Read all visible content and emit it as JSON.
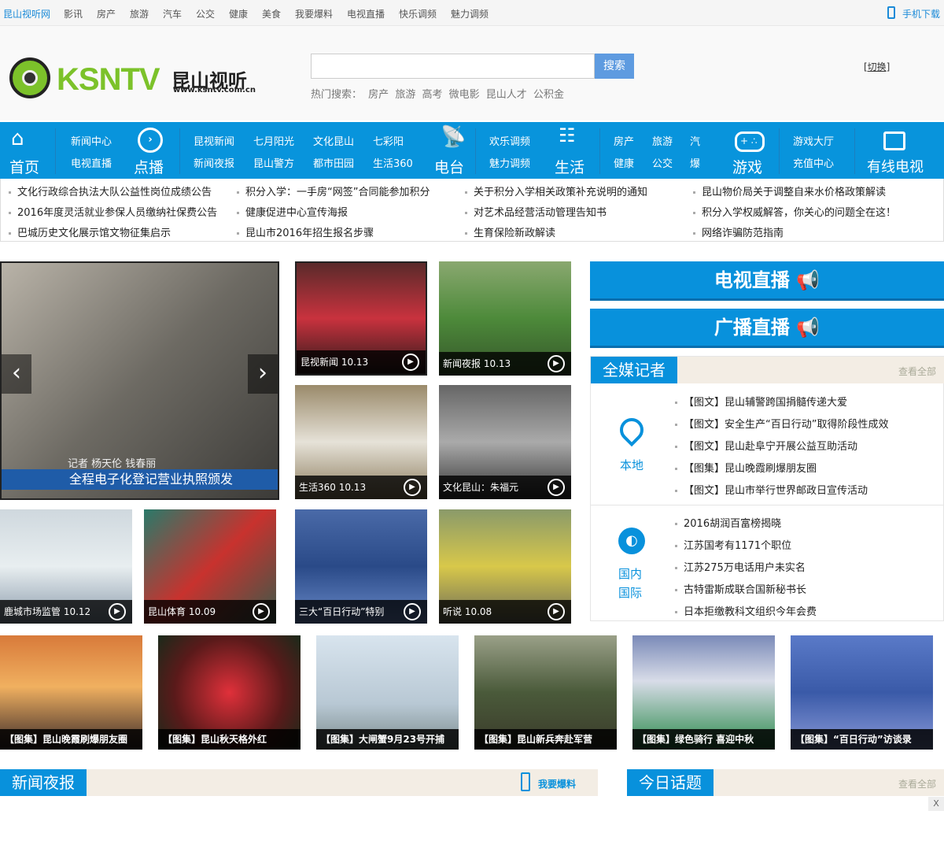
{
  "topbar": {
    "brand": "昆山视听网",
    "links": [
      "影讯",
      "房产",
      "旅游",
      "汽车",
      "公交",
      "健康",
      "美食",
      "我要爆料",
      "电视直播",
      "快乐调频",
      "魅力调频"
    ],
    "mobile": "手机下载"
  },
  "header": {
    "logo_text": "KSNTV昆山视听",
    "logo_url": "www.ksntv.com.cn",
    "search_button": "搜索",
    "search_value": "",
    "hot_label": "热门搜索：",
    "hot": [
      "房产",
      "旅游",
      "高考",
      "微电影",
      "昆山人才",
      "公积金"
    ],
    "switch": "[切换]"
  },
  "nav": {
    "home": "首页",
    "vod": "点播",
    "radio": "电台",
    "life": "生活",
    "game": "游戏",
    "cable": "有线电视",
    "g1": [
      "新闻中心",
      "电视直播"
    ],
    "g2": [
      "昆视新闻",
      "七月阳光",
      "文化昆山",
      "七彩阳",
      "新闻夜报",
      "昆山警方",
      "都市田园",
      "生活360"
    ],
    "g3": [
      "欢乐调频",
      "魅力调频"
    ],
    "g4": [
      "房产",
      "旅游",
      "汽",
      "健康",
      "公交",
      "爆"
    ],
    "g5": [
      "游戏大厅",
      "充值中心"
    ]
  },
  "notices": [
    [
      "文化行政综合执法大队公益性岗位成绩公告",
      "积分入学：一手房“网签”合同能参加积分",
      "关于积分入学相关政策补充说明的通知",
      "昆山物价局关于调整自来水价格政策解读"
    ],
    [
      "2016年度灵活就业参保人员缴纳社保费公告",
      "健康促进中心宣传海报",
      "对艺术品经营活动管理告知书",
      "积分入学权威解答，你关心的问题全在这！"
    ],
    [
      "巴城历史文化展示馆文物征集启示",
      "昆山市2016年招生报名步骤",
      "生育保险新政解读",
      "网络诈骗防范指南"
    ]
  ],
  "slider": {
    "caption": "全程电子化登记营业执照颁发",
    "sub": "记者 杨天伦 钱春丽"
  },
  "videos": [
    "昆视新闻 10.13",
    "新闻夜报 10.13",
    "生活360 10.13",
    "文化昆山：朱福元",
    "鹿城市场监管 10.12",
    "昆山体育 10.09",
    "三大“百日行动”特别",
    "听说 10.08"
  ],
  "live": {
    "tv": "电视直播",
    "radio": "广播直播"
  },
  "reporter": {
    "title": "全媒记者",
    "more": "查看全部",
    "local": "本地",
    "local_items": [
      "【图文】昆山辅警跨国捐髓传递大爱",
      "【图文】安全生产“百日行动”取得阶段性成效",
      "【图文】昆山赴阜宁开展公益互助活动",
      "【图集】昆山晚霞刷爆朋友圈",
      "【图文】昆山市举行世界邮政日宣传活动"
    ],
    "nation1": "国内",
    "nation2": "国际",
    "nation_items": [
      "2016胡润百富榜揭晓",
      "江苏国考有1171个职位",
      "江苏275万电话用户未实名",
      "古特雷斯成联合国新秘书长",
      "日本拒缴教科文组织今年会费"
    ]
  },
  "photos": [
    "【图集】昆山晚霞刷爆朋友圈",
    "【图集】昆山秋天格外红",
    "【图集】大闸蟹9月23号开捕",
    "【图集】昆山新兵奔赴军营",
    "【图集】绿色骑行 喜迎中秋",
    "【图集】“百日行动”访谈录"
  ],
  "bottom": {
    "news": "新闻夜报",
    "report": "我要爆料",
    "topic": "今日话题",
    "more": "查看全部",
    "close": "X"
  }
}
